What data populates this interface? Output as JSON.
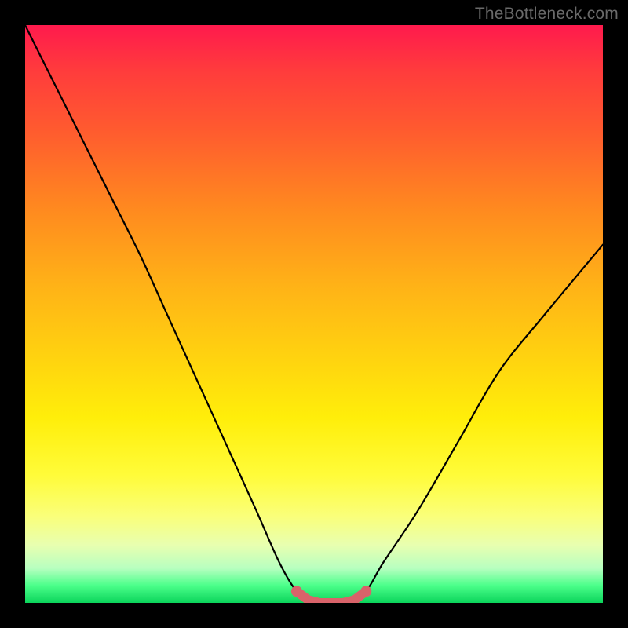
{
  "watermark": "TheBottleneck.com",
  "colors": {
    "background": "#000000",
    "curve_stroke": "#000000",
    "marker_fill": "#d9636a",
    "gradient_stops": [
      "#ff1a4d",
      "#ff3c3c",
      "#ff5a2f",
      "#ff8a1f",
      "#ffb217",
      "#ffd40f",
      "#ffee0a",
      "#fffc3a",
      "#faff7a",
      "#e8ffb0",
      "#b8ffc0",
      "#4bff8a",
      "#0bd45b"
    ]
  },
  "chart_data": {
    "type": "line",
    "title": "",
    "xlabel": "",
    "ylabel": "",
    "xlim": [
      0,
      100
    ],
    "ylim": [
      0,
      100
    ],
    "series": [
      {
        "name": "bottleneck-curve",
        "x": [
          0,
          5,
          10,
          15,
          20,
          25,
          30,
          35,
          40,
          44,
          47,
          50,
          53,
          56,
          59,
          62,
          68,
          75,
          82,
          90,
          100
        ],
        "values": [
          100,
          90,
          80,
          70,
          60,
          49,
          38,
          27,
          16,
          7,
          2,
          0,
          0,
          0,
          2,
          7,
          16,
          28,
          40,
          50,
          62
        ]
      }
    ],
    "markers": {
      "name": "highlight-zone",
      "x": [
        47,
        49,
        51,
        53,
        55,
        57,
        59
      ],
      "values": [
        2,
        0.5,
        0,
        0,
        0,
        0.5,
        2
      ]
    },
    "annotations": []
  }
}
